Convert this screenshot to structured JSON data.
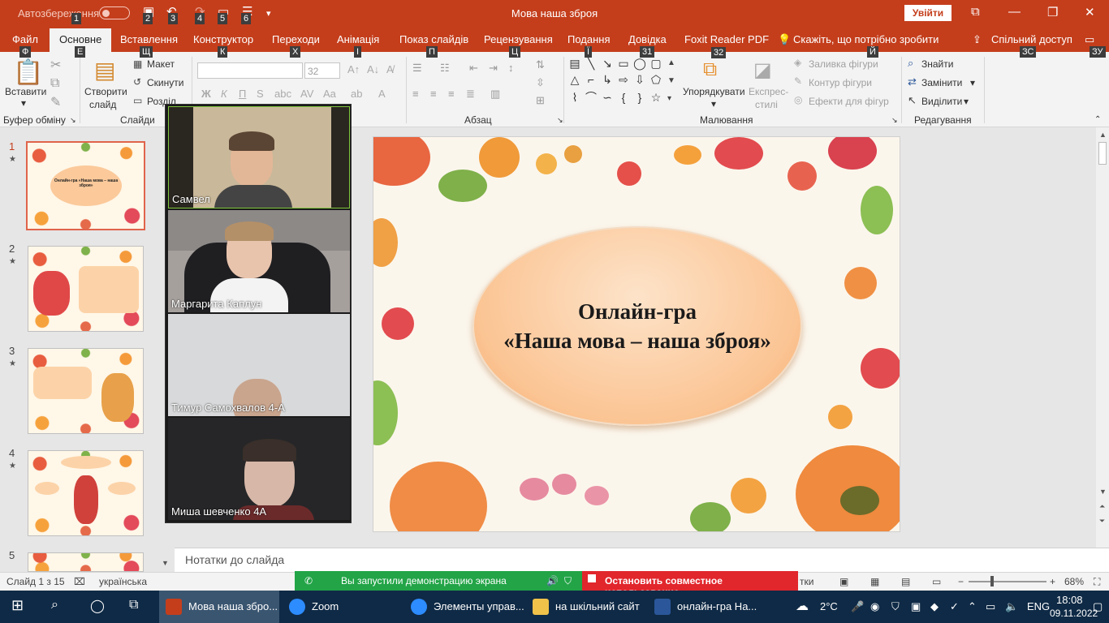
{
  "titlebar": {
    "autosave": "Автозбереження",
    "doc_title": "Мова наша зброя",
    "signin": "Увійти",
    "qat_keys": [
      "1",
      "2",
      "3",
      "4",
      "5",
      "6"
    ]
  },
  "menu": {
    "tabs": [
      "Файл",
      "Основне",
      "Вставлення",
      "Конструктор",
      "Переходи",
      "Анімація",
      "Показ слайдів",
      "Рецензування",
      "Подання",
      "Довідка",
      "Foxit Reader PDF",
      "Скажіть, що потрібно зробити",
      "Спільний доступ"
    ],
    "keys": [
      "Ф",
      "Е",
      "Щ",
      "К",
      "Х",
      "І",
      "П",
      "Ц",
      "Ї",
      "31",
      "Й",
      "ЗС",
      "ЗУ",
      "32"
    ]
  },
  "ribbon": {
    "paste": "Вставити",
    "new_slide": "Створити",
    "new_slide2": "слайд",
    "layout": "Макет",
    "reset": "Скинути",
    "section": "Розділ",
    "font_size": "32",
    "arrange": "Упорядкувати",
    "quick_styles": "Експрес-",
    "quick_styles2": "стилі",
    "fill": "Заливка фігури",
    "outline": "Контур фігури",
    "effects": "Ефекти для фігур",
    "find": "Знайти",
    "replace": "Замінити",
    "select": "Виділити",
    "groups": {
      "clipboard": "Буфер обміну",
      "slides": "Слайди",
      "paragraph": "Абзац",
      "drawing": "Малювання",
      "editing": "Редагування"
    }
  },
  "thumbnails": [
    {
      "num": "1",
      "caption": "Онлайн-гра «Наша мова – наша зброя»"
    },
    {
      "num": "2",
      "caption": ""
    },
    {
      "num": "3",
      "caption": ""
    },
    {
      "num": "4",
      "caption": ""
    },
    {
      "num": "5",
      "caption": ""
    }
  ],
  "videos": [
    {
      "name": "Самвел"
    },
    {
      "name": "Маргарита Каплун"
    },
    {
      "name": "Тимур Самохвалов 4-А"
    },
    {
      "name": "Миша шевченко 4А"
    }
  ],
  "slide": {
    "line1": "Онлайн-гра",
    "line2": "«Наша мова – наша зброя»"
  },
  "notes_placeholder": "Нотатки до слайда",
  "status": {
    "slide": "Слайд 1 з 15",
    "language": "українська",
    "notes_fragment": "тки",
    "zoom": "68%"
  },
  "zoom_bar": {
    "sharing": "Вы запустили демонстрацию экрана",
    "stop": "Остановить совместное использование"
  },
  "taskbar": {
    "items": [
      "Мова наша збро...",
      "Zoom",
      "Элементы управ...",
      "на шкільний сайт",
      "онлайн-гра На..."
    ],
    "weather": "2°C",
    "lang": "ENG",
    "time": "18:08",
    "date": "09.11.2022"
  },
  "colors": {
    "accent": "#c43e1c",
    "zoom_green": "#22a447",
    "zoom_red": "#e1262c",
    "taskbar": "#0f2a46"
  }
}
